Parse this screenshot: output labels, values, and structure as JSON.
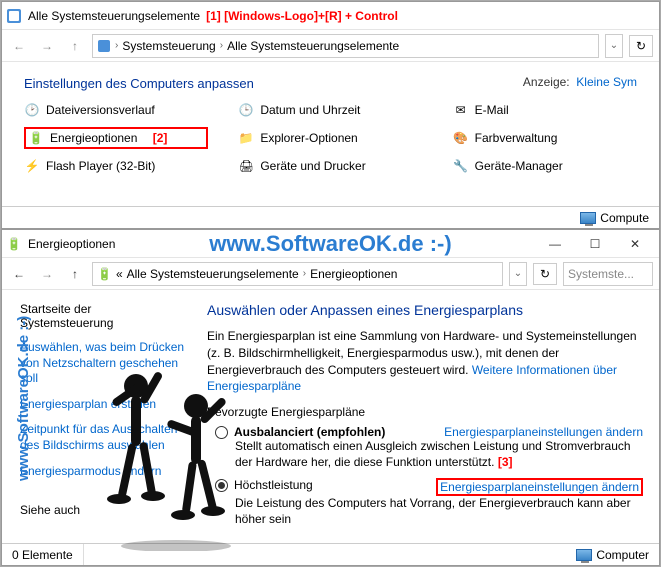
{
  "annotations": {
    "a1": "[1] [Windows-Logo]+[R] + Control",
    "a2": "[2]",
    "a3": "[3]"
  },
  "watermark": "www.SoftwareOK.de :-)",
  "window1": {
    "title": "Alle Systemsteuerungselemente",
    "crumbs": {
      "c1": "Systemsteuerung",
      "c2": "Alle Systemsteuerungselemente"
    },
    "heading": "Einstellungen des Computers anpassen",
    "view_label": "Anzeige:",
    "view_value": "Kleine Sym",
    "items": {
      "i0": "Dateiversionsverlauf",
      "i1": "Datum und Uhrzeit",
      "i2": "E-Mail",
      "i3": "Energieoptionen",
      "i4": "Explorer-Optionen",
      "i5": "Farbverwaltung",
      "i6": "Flash Player (32-Bit)",
      "i7": "Geräte und Drucker",
      "i8": "Geräte-Manager"
    },
    "status_right": "Compute"
  },
  "window2": {
    "title": "Energieoptionen",
    "crumbs": {
      "c0": "«",
      "c1": "Alle Systemsteuerungselemente",
      "c2": "Energieoptionen"
    },
    "search_ph": "Systemste...",
    "sidebar": {
      "home": "Startseite der Systemsteuerung",
      "l1": "Auswählen, was beim Drücken von Netzschaltern geschehen soll",
      "l2": "Energiesparplan erstellen",
      "l3": "Zeitpunkt für das Ausschalten des Bildschirms auswählen",
      "l4": "Energiesparmodus ändern",
      "see": "Siehe auch"
    },
    "main": {
      "h1": "Auswählen oder Anpassen eines Energiesparplans",
      "p1": "Ein Energiesparplan ist eine Sammlung von Hardware- und Systemeinstellungen (z. B. Bildschirmhelligkeit, Energiesparmodus usw.), mit denen der Energieverbrauch des Computers gesteuert wird.",
      "more": "Weitere Informationen über Energiesparpläne",
      "sub": "Bevorzugte Energiesparpläne",
      "plan1_name": "Ausbalanciert (empfohlen)",
      "plan1_desc": "Stellt automatisch einen Ausgleich zwischen Leistung und Stromverbrauch der Hardware her, die diese Funktion unterstützt.",
      "plan2_name": "Höchstleistung",
      "plan2_desc": "Die Leistung des Computers hat Vorrang, der Energieverbrauch kann aber höher sein",
      "change": "Energiesparplaneinstellungen ändern"
    },
    "status_left": "0 Elemente",
    "status_right": "Computer"
  }
}
